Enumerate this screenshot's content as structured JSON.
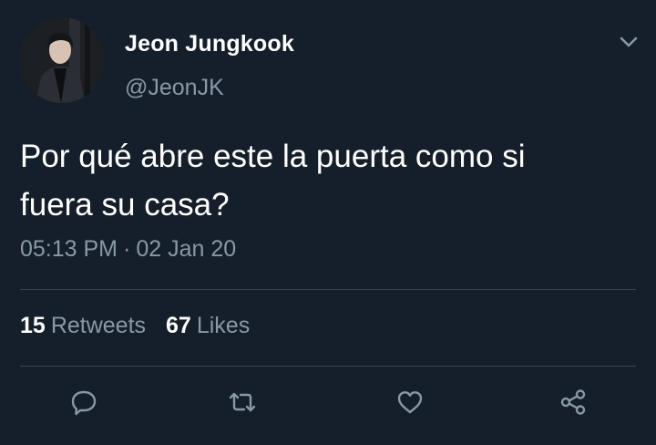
{
  "user": {
    "display_name": "Jeon Jungkook",
    "handle": "@JeonJK"
  },
  "tweet": {
    "text_line1": "Por qué abre este la puerta como si",
    "text_line2": "fuera su casa?",
    "time": "05:13 PM",
    "separator": "·",
    "date": "02 Jan 20"
  },
  "stats": {
    "retweets_count": "15",
    "retweets_label": "Retweets",
    "likes_count": "67",
    "likes_label": "Likes"
  },
  "actions": [
    "reply-icon",
    "retweet-icon",
    "like-icon",
    "share-icon"
  ],
  "colors": {
    "background": "#151f2b",
    "secondary_text": "#8899a6",
    "divider": "#38444d"
  }
}
